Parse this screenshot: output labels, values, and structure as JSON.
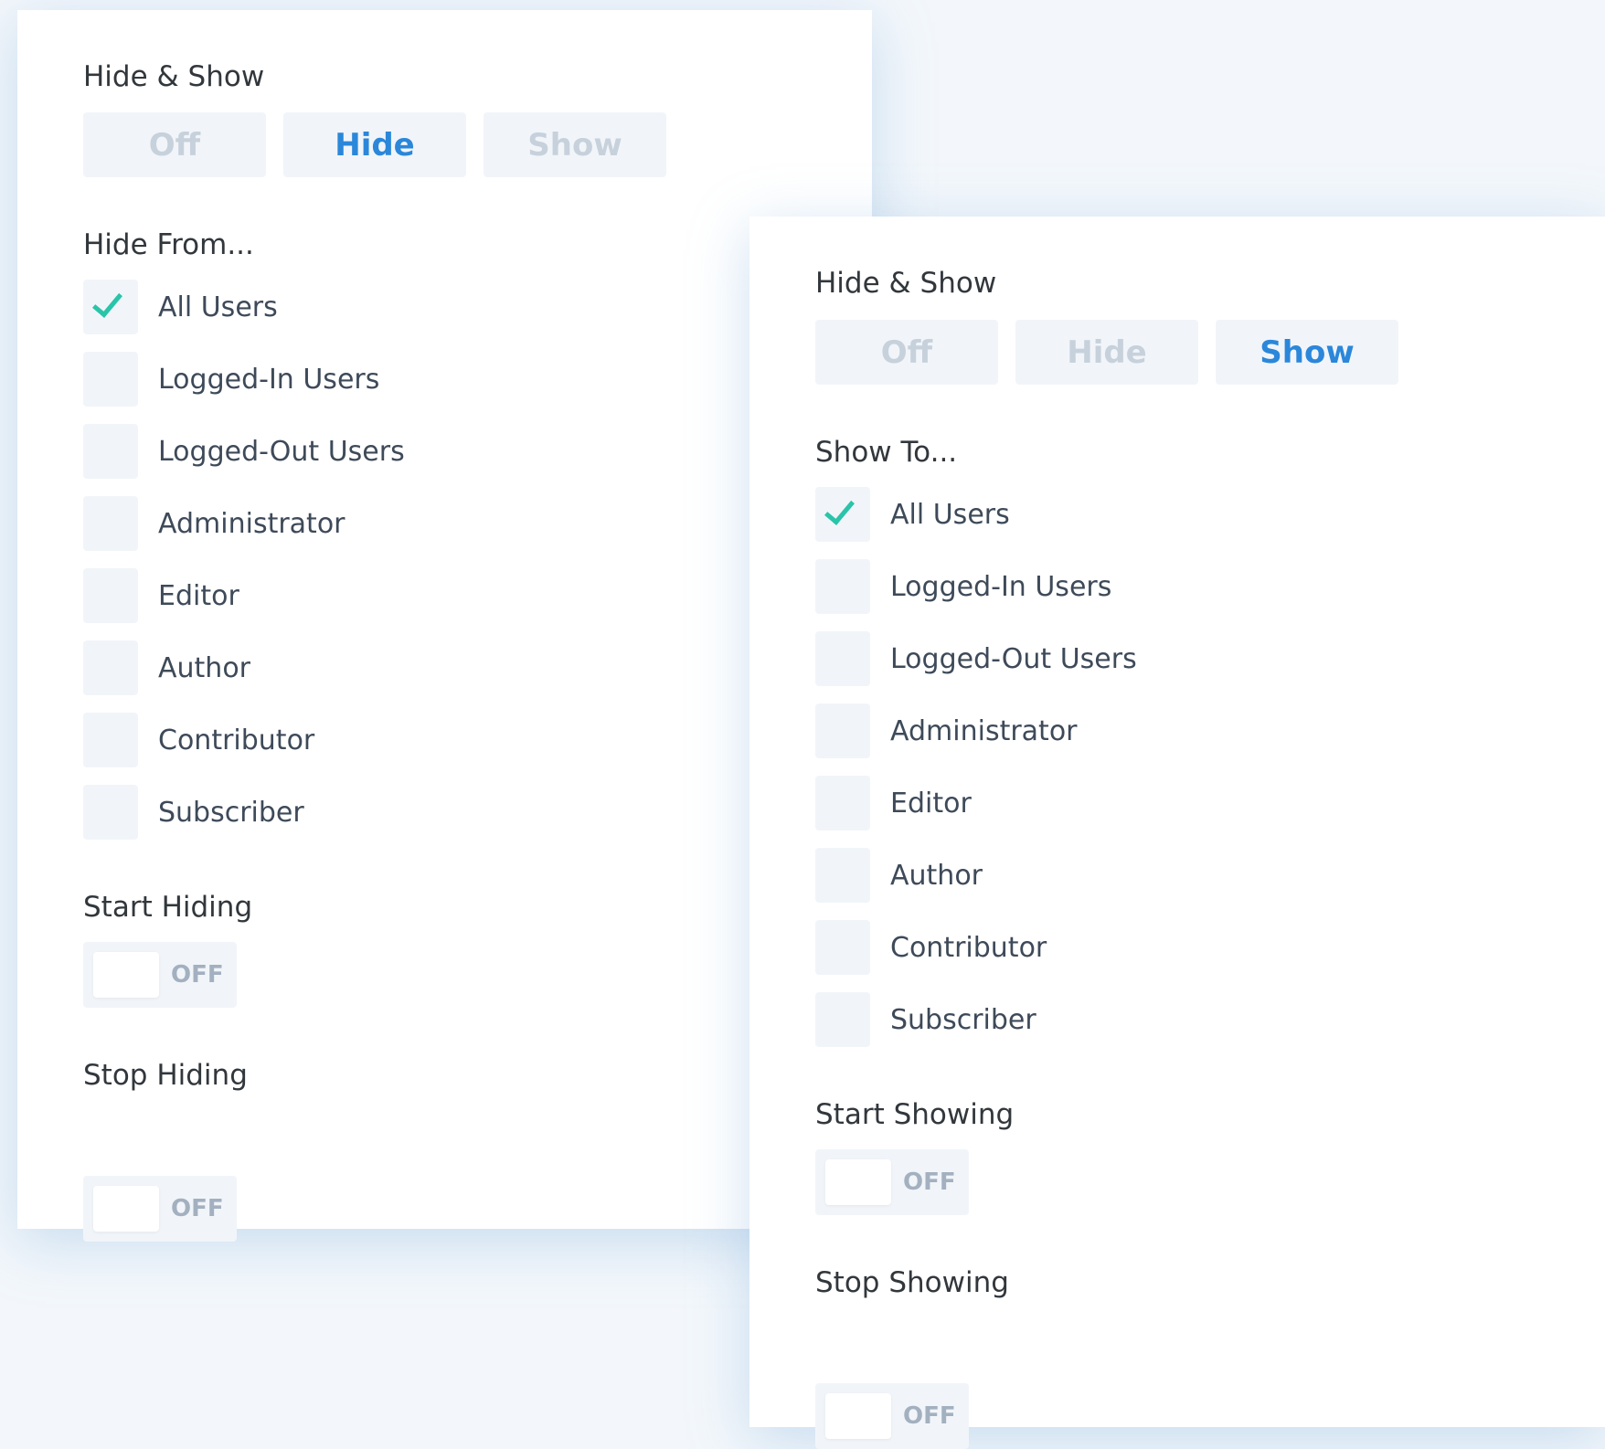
{
  "hide_panel": {
    "mode_title": "Hide & Show",
    "mode_options": [
      "Off",
      "Hide",
      "Show"
    ],
    "selected_mode": "Hide",
    "audience_title": "Hide From...",
    "audience": [
      {
        "label": "All Users",
        "checked": true
      },
      {
        "label": "Logged-In Users",
        "checked": false
      },
      {
        "label": "Logged-Out Users",
        "checked": false
      },
      {
        "label": "Administrator",
        "checked": false
      },
      {
        "label": "Editor",
        "checked": false
      },
      {
        "label": "Author",
        "checked": false
      },
      {
        "label": "Contributor",
        "checked": false
      },
      {
        "label": "Subscriber",
        "checked": false
      }
    ],
    "start_label": "Start Hiding",
    "start_toggle": "OFF",
    "stop_label": "Stop Hiding",
    "stop_toggle": "OFF"
  },
  "show_panel": {
    "mode_title": "Hide & Show",
    "mode_options": [
      "Off",
      "Hide",
      "Show"
    ],
    "selected_mode": "Show",
    "audience_title": "Show To...",
    "audience": [
      {
        "label": "All Users",
        "checked": true
      },
      {
        "label": "Logged-In Users",
        "checked": false
      },
      {
        "label": "Logged-Out Users",
        "checked": false
      },
      {
        "label": "Administrator",
        "checked": false
      },
      {
        "label": "Editor",
        "checked": false
      },
      {
        "label": "Author",
        "checked": false
      },
      {
        "label": "Contributor",
        "checked": false
      },
      {
        "label": "Subscriber",
        "checked": false
      }
    ],
    "start_label": "Start Showing",
    "start_toggle": "OFF",
    "stop_label": "Stop Showing",
    "stop_toggle": "OFF"
  },
  "colors": {
    "active_text": "#2b87da",
    "inactive_text": "#c7d1dc",
    "check_mark": "#29c4a9",
    "control_bg": "#f1f5f9"
  }
}
